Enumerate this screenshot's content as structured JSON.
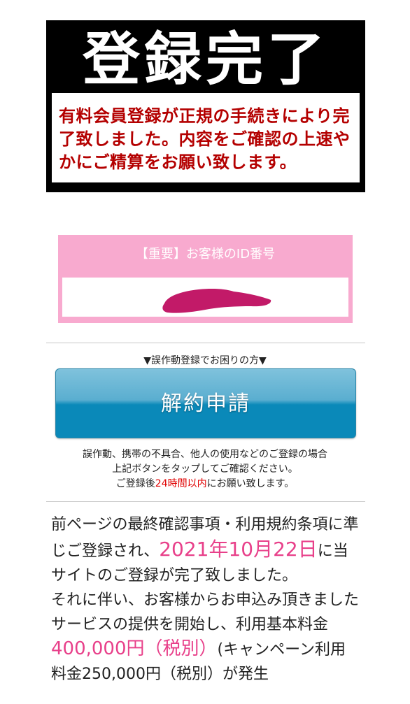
{
  "banner": {
    "title": "登録完了",
    "message": "有料会員登録が正規の手続きにより完了致しました。内容をご確認の上速やかにご精算をお願い致します。"
  },
  "id_section": {
    "label": "【重要】お客様のID番号"
  },
  "help": {
    "heading": "▼誤作動登録でお困りの方▼",
    "button_label": "解約申請",
    "note_line1": "誤作動、携帯の不具合、他人の使用などのご登録の場合",
    "note_line2": "上記ボタンをタップしてご確認ください。",
    "note_line3_before": "ご登録後",
    "note_line3_highlight": "24時間以内",
    "note_line3_after": "にお願い致します。"
  },
  "body": {
    "part1": "前ページの最終確認事項・利用規約条項に準じご登録され、",
    "date": "2021年10月22日",
    "part2": "に当サイトのご登録が完了致しました。",
    "part3": "それに伴い、お客様からお申込み頂きましたサービスの提供を開始し、利用基本料金",
    "fee": "400,000円（税別）",
    "part4": "(キャンペーン利用料金250,000円（税別）が発生"
  },
  "colors": {
    "banner_bg": "#000000",
    "banner_message": "#b40000",
    "id_box_bg": "#f8aacf",
    "scribble": "#c21a68",
    "button_blue": "#0a89b9",
    "highlight_red": "#e00000",
    "highlight_pink": "#e8408a"
  }
}
